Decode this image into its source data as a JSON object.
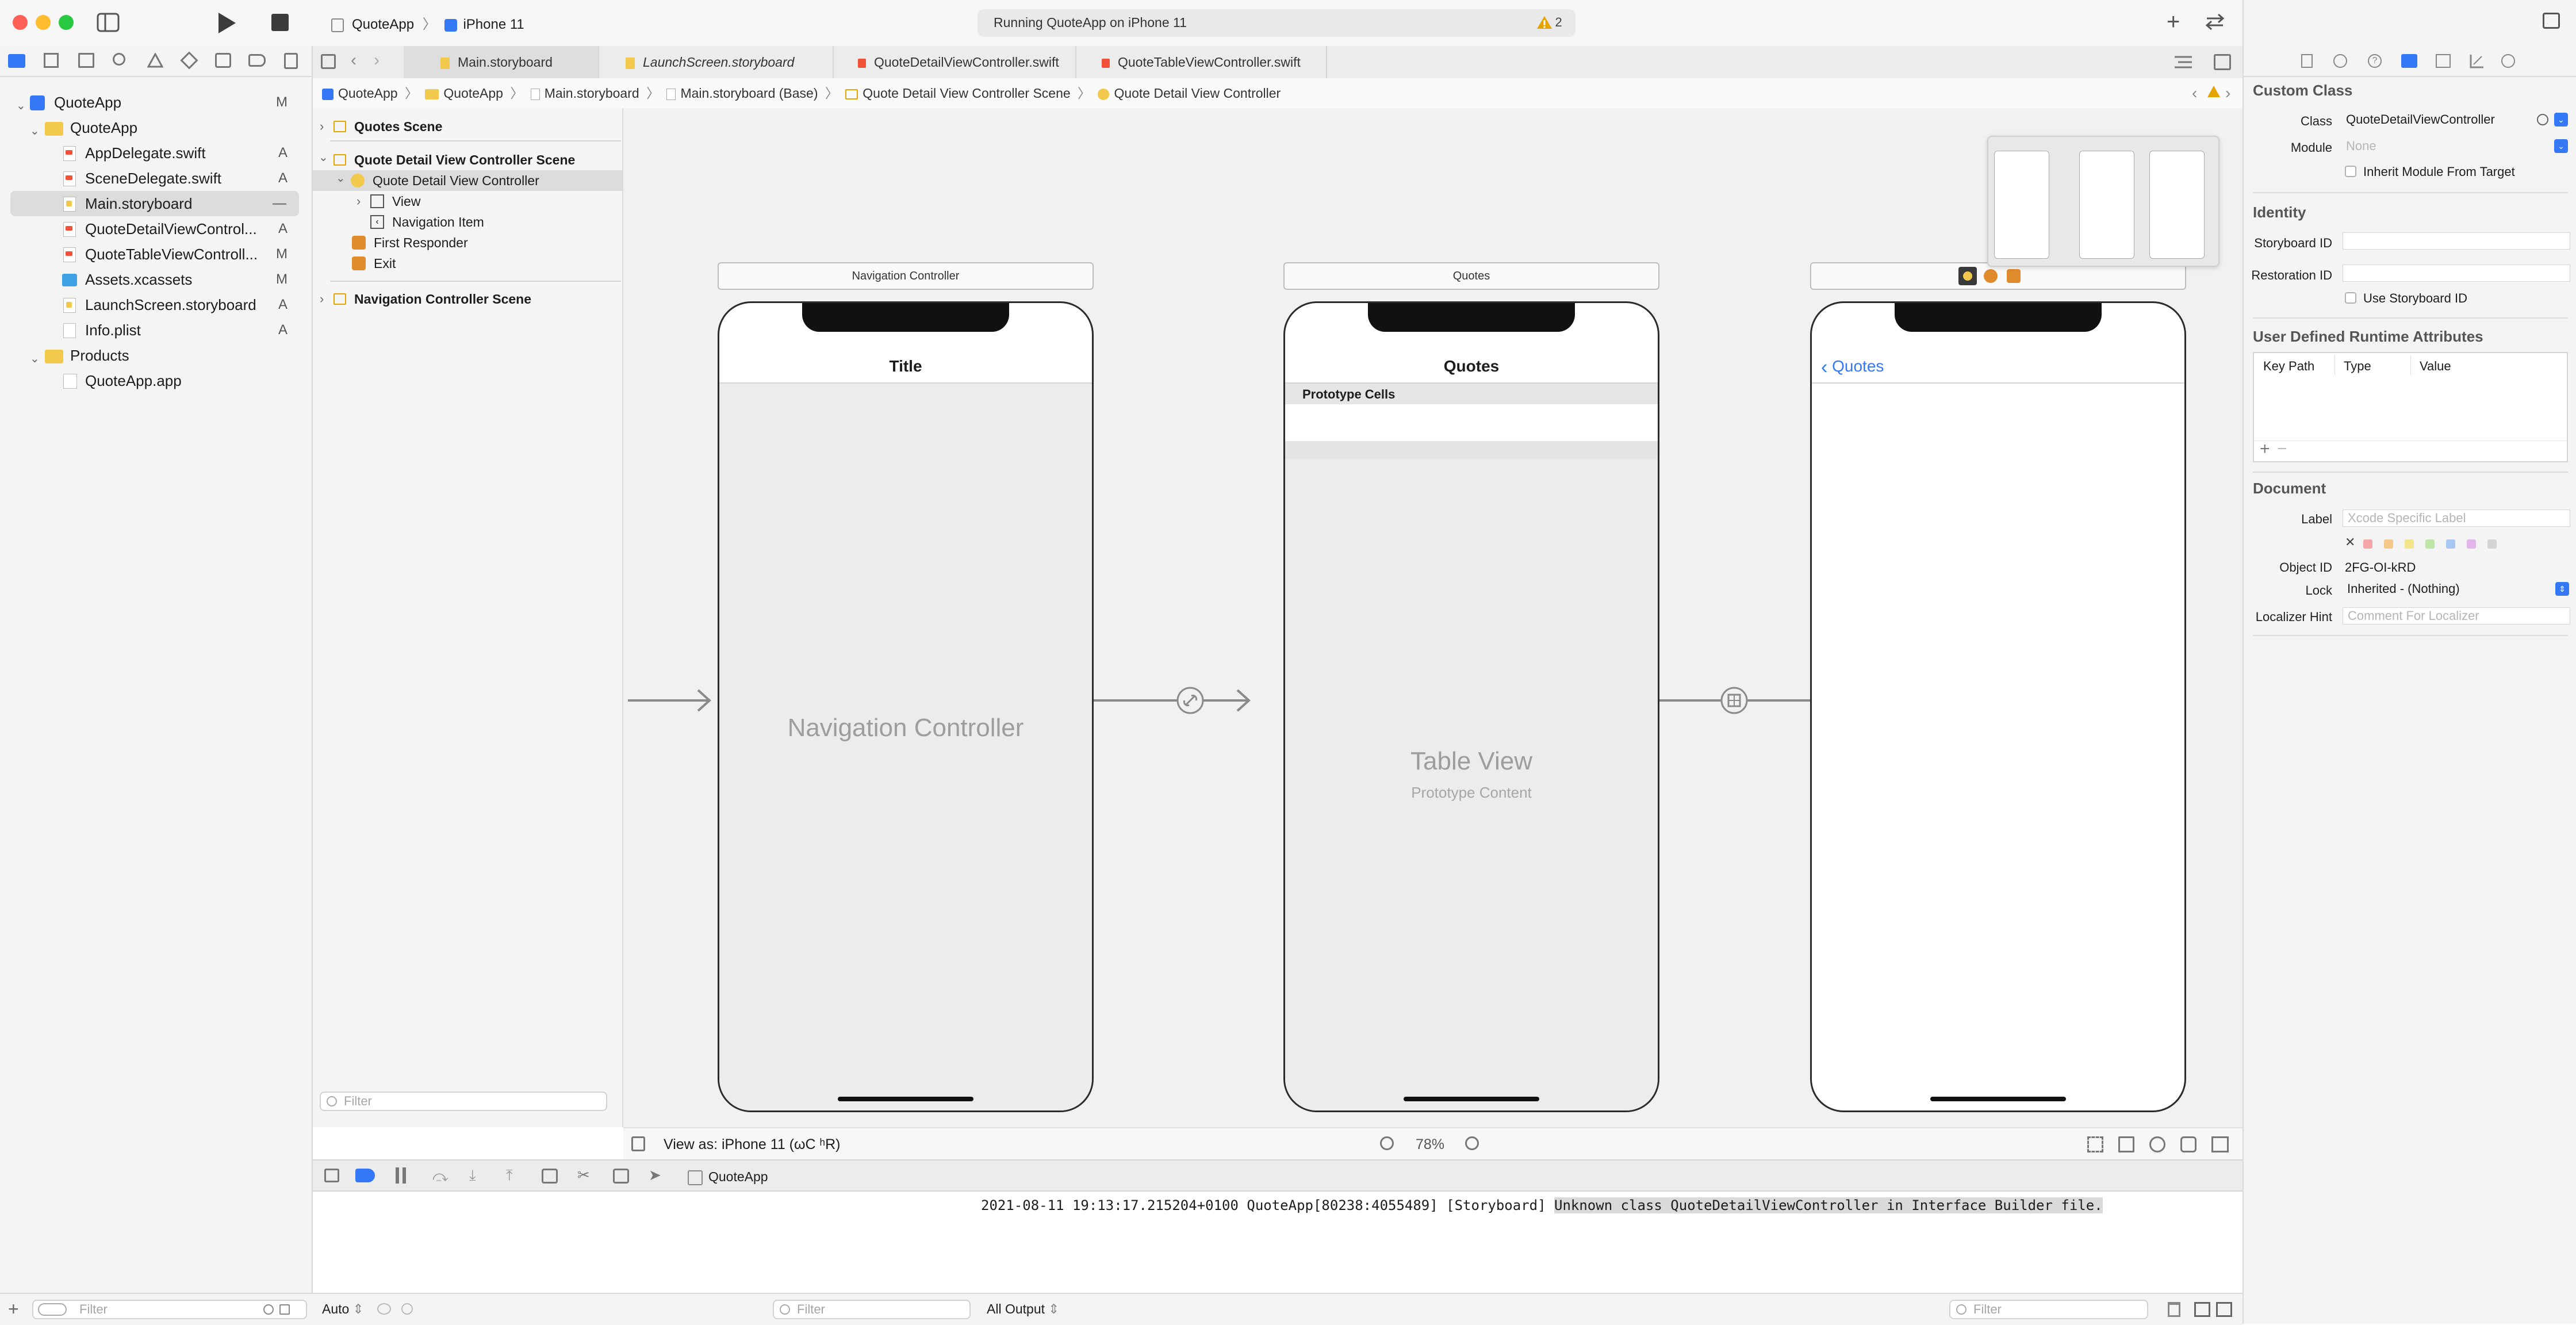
{
  "window": {
    "scheme": "QuoteApp",
    "device": "iPhone 11",
    "status": "Running QuoteApp on iPhone 11",
    "warning_count": "2"
  },
  "tabs": [
    {
      "label": "Main.storyboard"
    },
    {
      "label": "LaunchScreen.storyboard"
    },
    {
      "label": "QuoteDetailViewController.swift"
    },
    {
      "label": "QuoteTableViewController.swift"
    }
  ],
  "navigator": {
    "items": [
      {
        "label": "QuoteApp",
        "status": "M"
      },
      {
        "label": "QuoteApp",
        "status": ""
      },
      {
        "label": "AppDelegate.swift",
        "status": "A"
      },
      {
        "label": "SceneDelegate.swift",
        "status": "A"
      },
      {
        "label": "Main.storyboard",
        "status": "—"
      },
      {
        "label": "QuoteDetailViewControl...",
        "status": "A"
      },
      {
        "label": "QuoteTableViewControll...",
        "status": "M"
      },
      {
        "label": "Assets.xcassets",
        "status": "M"
      },
      {
        "label": "LaunchScreen.storyboard",
        "status": "A"
      },
      {
        "label": "Info.plist",
        "status": "A"
      },
      {
        "label": "Products",
        "status": ""
      },
      {
        "label": "QuoteApp.app",
        "status": ""
      }
    ],
    "filter_placeholder": "Filter"
  },
  "jumpbar": [
    "QuoteApp",
    "QuoteApp",
    "Main.storyboard",
    "Main.storyboard (Base)",
    "Quote Detail View Controller Scene",
    "Quote Detail View Controller"
  ],
  "outline": {
    "items": [
      {
        "label": "Quotes Scene"
      },
      {
        "label": "Quote Detail View Controller Scene"
      },
      {
        "label": "Quote Detail View Controller"
      },
      {
        "label": "View"
      },
      {
        "label": "Navigation Item"
      },
      {
        "label": "First Responder"
      },
      {
        "label": "Exit"
      },
      {
        "label": "Navigation Controller Scene"
      }
    ],
    "filter_placeholder": "Filter"
  },
  "canvas": {
    "scene1": {
      "header": "Navigation Controller",
      "nav_title": "Title",
      "placeholder": "Navigation Controller"
    },
    "scene2": {
      "header": "Quotes",
      "nav_title": "Quotes",
      "section": "Prototype Cells",
      "placeholder_title": "Table View",
      "placeholder_sub": "Prototype Content"
    },
    "scene3": {
      "back_label": "Quotes"
    },
    "view_as": "View as: iPhone 11 (ωC ʰR)",
    "zoom": "78%"
  },
  "debug": {
    "process": "QuoteApp",
    "console_prefix": "2021-08-11 19:13:17.215204+0100 QuoteApp[80238:4055489] [Storyboard] ",
    "console_highlight": "Unknown class QuoteDetailViewController in Interface Builder file.",
    "auto_label": "Auto",
    "output_label": "All Output",
    "filter_placeholder": "Filter"
  },
  "inspector": {
    "custom_class_title": "Custom Class",
    "class_label": "Class",
    "class_value": "QuoteDetailViewController",
    "module_label": "Module",
    "module_placeholder": "None",
    "inherit_label": "Inherit Module From Target",
    "identity_title": "Identity",
    "storyboard_id_label": "Storyboard ID",
    "restoration_id_label": "Restoration ID",
    "use_storyboard_id_label": "Use Storyboard ID",
    "runtime_title": "User Defined Runtime Attributes",
    "col_keypath": "Key Path",
    "col_type": "Type",
    "col_value": "Value",
    "document_title": "Document",
    "label_label": "Label",
    "label_placeholder": "Xcode Specific Label",
    "object_id_label": "Object ID",
    "object_id_value": "2FG-OI-kRD",
    "lock_label": "Lock",
    "lock_value": "Inherited - (Nothing)",
    "localizer_label": "Localizer Hint",
    "localizer_placeholder": "Comment For Localizer"
  },
  "colors": {
    "accent": "#3478f6",
    "selection": "#dcdcdc",
    "folder": "#f2c94c",
    "warning": "#e6a400",
    "canvas_bg": "#f1f1f1",
    "console_highlight_bg": "#dadada"
  }
}
